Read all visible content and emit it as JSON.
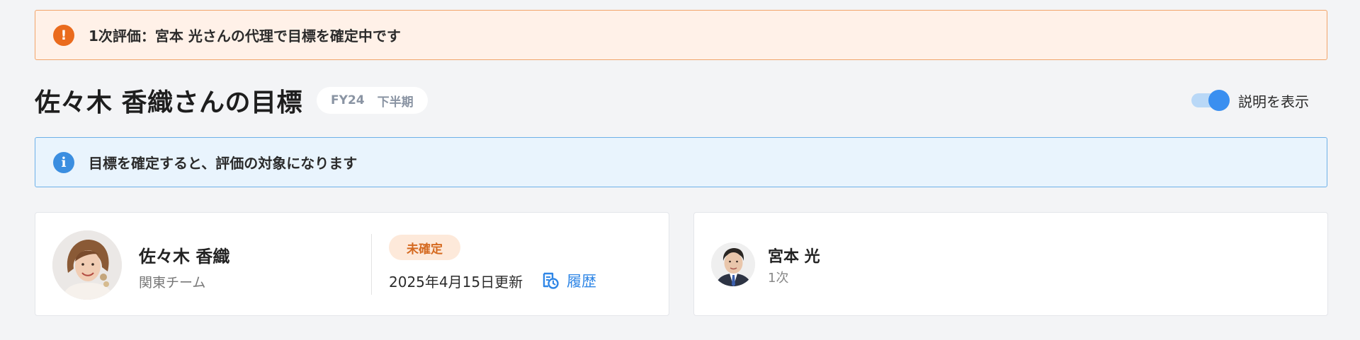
{
  "alerts": {
    "proxy_message": "1次評価：宮本 光さんの代理で目標を確定中です",
    "info_message": "目標を確定すると、評価の対象になります"
  },
  "header": {
    "title": "佐々木 香織さんの目標",
    "period": {
      "fiscal_year": "FY24",
      "half": "下半期"
    },
    "toggle": {
      "label": "説明を表示",
      "on": true
    }
  },
  "employee": {
    "name": "佐々木 香織",
    "team": "関東チーム",
    "status": "未確定",
    "updated": "2025年4月15日更新",
    "history_label": "履歴"
  },
  "evaluator": {
    "name": "宮本 光",
    "role": "1次"
  },
  "colors": {
    "warning": "#ea6b1d",
    "info": "#3b8ee0",
    "link": "#2f86e6",
    "badge_bg": "#fde9da",
    "badge_text": "#d56a20"
  },
  "icons": {
    "warning": "exclamation-icon",
    "info": "info-icon",
    "history": "history-icon"
  }
}
